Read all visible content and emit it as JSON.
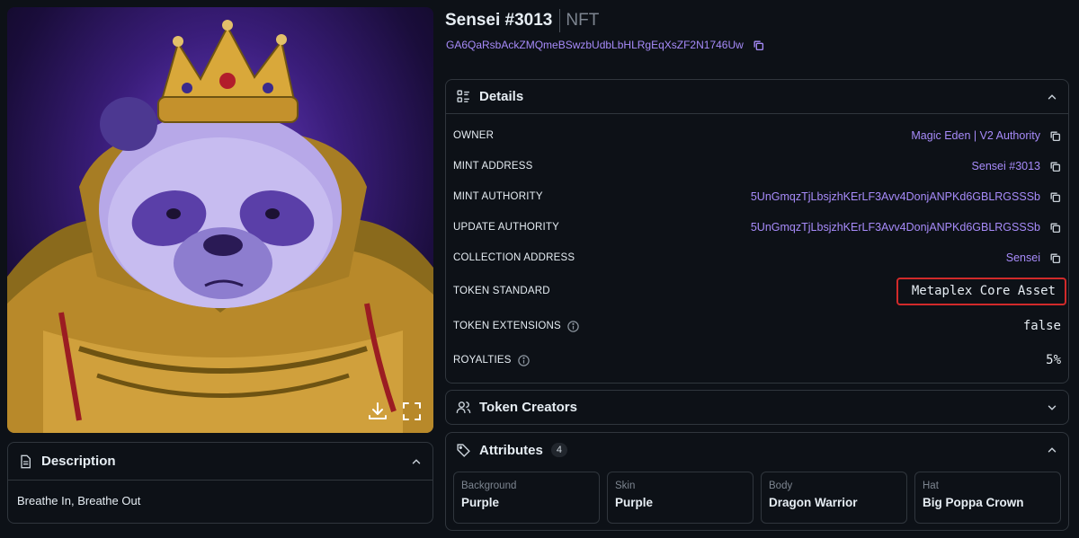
{
  "header": {
    "name": "Sensei #3013",
    "type": "NFT",
    "address": "GA6QaRsbAckZMQmeBSwzbUdbLbHLRgEqXsZF2N1746Uw"
  },
  "description": {
    "title": "Description",
    "text": "Breathe In, Breathe Out"
  },
  "details": {
    "title": "Details",
    "rows": [
      {
        "label": "OWNER",
        "value": "Magic Eden | V2 Authority"
      },
      {
        "label": "MINT ADDRESS",
        "value": "Sensei #3013"
      },
      {
        "label": "MINT AUTHORITY",
        "value": "5UnGmqzTjLbsjzhKErLF3Avv4DonjANPKd6GBLRGSSSb"
      },
      {
        "label": "UPDATE AUTHORITY",
        "value": "5UnGmqzTjLbsjzhKErLF3Avv4DonjANPKd6GBLRGSSSb"
      },
      {
        "label": "COLLECTION ADDRESS",
        "value": "Sensei"
      },
      {
        "label": "TOKEN STANDARD",
        "value": "Metaplex Core Asset"
      },
      {
        "label": "TOKEN EXTENSIONS",
        "value": "false"
      },
      {
        "label": "ROYALTIES",
        "value": "5%"
      }
    ]
  },
  "creators": {
    "title": "Token Creators"
  },
  "attributes": {
    "title": "Attributes",
    "count": "4",
    "items": [
      {
        "trait_type": "Background",
        "value": "Purple"
      },
      {
        "trait_type": "Skin",
        "value": "Purple"
      },
      {
        "trait_type": "Body",
        "value": "Dragon Warrior"
      },
      {
        "trait_type": "Hat",
        "value": "Big Poppa Crown"
      }
    ]
  },
  "colors": {
    "background": "#0d1117",
    "border": "#30363d",
    "link": "#a78bfa",
    "highlight": "#d12a2a"
  }
}
